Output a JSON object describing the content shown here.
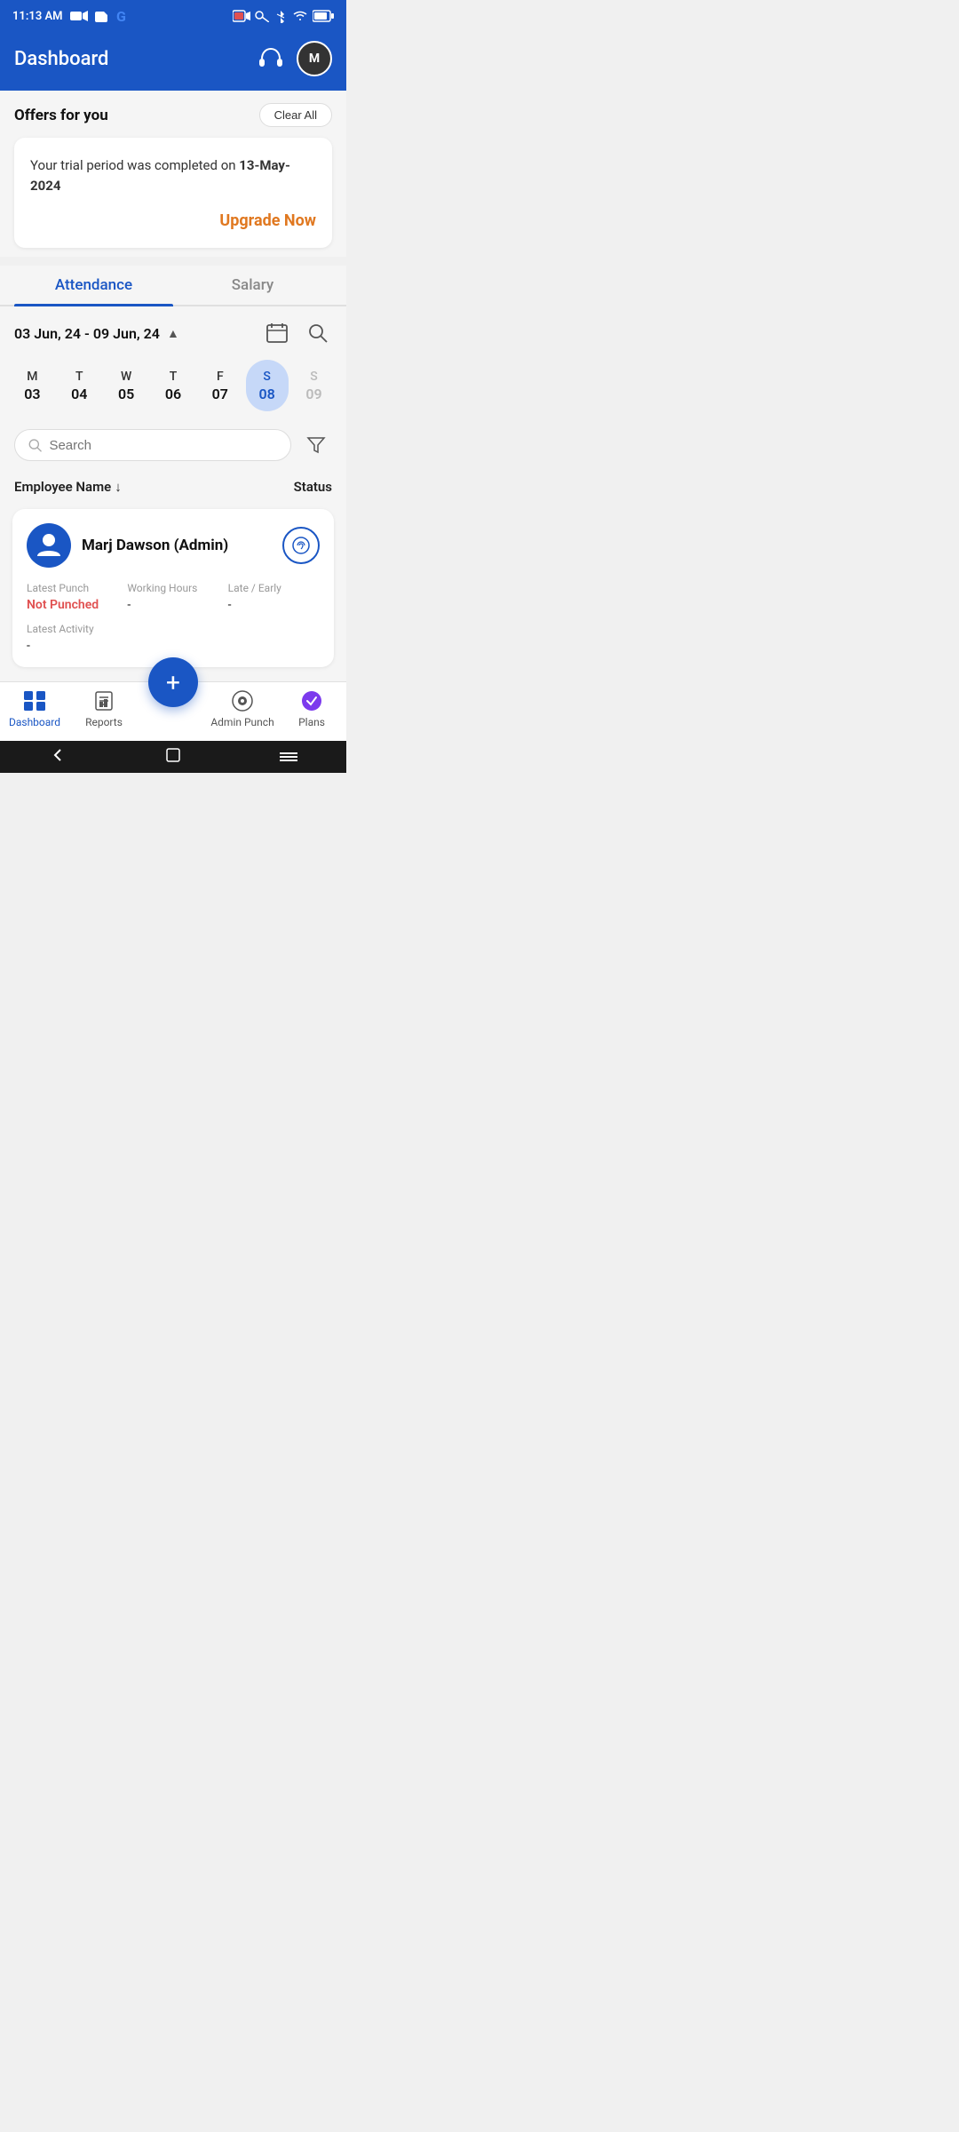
{
  "statusBar": {
    "time": "11:13 AM",
    "icons": [
      "video-icon",
      "sim-icon",
      "google-icon",
      "record-icon",
      "key-icon",
      "bluetooth-icon",
      "wifi-icon",
      "battery-icon"
    ]
  },
  "header": {
    "title": "Dashboard",
    "headsetAlt": "headset",
    "avatarInitial": "M"
  },
  "offers": {
    "sectionTitle": "Offers for you",
    "clearAllLabel": "Clear All",
    "offerMessage1": "Your trial period was completed on ",
    "offerDate": "13-May-2024",
    "upgradeLabel": "Upgrade Now"
  },
  "tabs": [
    {
      "id": "attendance",
      "label": "Attendance",
      "active": true
    },
    {
      "id": "salary",
      "label": "Salary",
      "active": false
    }
  ],
  "dateRange": {
    "text": "03 Jun, 24 - 09 Jun, 24",
    "chevron": "▲"
  },
  "days": [
    {
      "letter": "M",
      "num": "03",
      "active": false,
      "muted": false
    },
    {
      "letter": "T",
      "num": "04",
      "active": false,
      "muted": false
    },
    {
      "letter": "W",
      "num": "05",
      "active": false,
      "muted": false
    },
    {
      "letter": "T",
      "num": "06",
      "active": false,
      "muted": false
    },
    {
      "letter": "F",
      "num": "07",
      "active": false,
      "muted": false
    },
    {
      "letter": "S",
      "num": "08",
      "active": true,
      "muted": false
    },
    {
      "letter": "S",
      "num": "09",
      "active": false,
      "muted": true
    }
  ],
  "search": {
    "placeholder": "Search"
  },
  "table": {
    "colEmployee": "Employee Name",
    "colStatus": "Status",
    "sortIcon": "↓"
  },
  "employees": [
    {
      "name": "Marj Dawson (Admin)",
      "latestPunchLabel": "Latest Punch",
      "latestPunchValue": "Not Punched",
      "workingHoursLabel": "Working Hours",
      "workingHoursValue": "-",
      "lateEarlyLabel": "Late / Early",
      "lateEarlyValue": "-",
      "latestActivityLabel": "Latest Activity",
      "latestActivityValue": "-"
    }
  ],
  "bottomNav": {
    "fabLabel": "+",
    "items": [
      {
        "id": "dashboard",
        "label": "Dashboard",
        "active": true
      },
      {
        "id": "reports",
        "label": "Reports",
        "active": false
      },
      {
        "id": "fab-spacer",
        "label": "",
        "active": false
      },
      {
        "id": "admin-punch",
        "label": "Admin Punch",
        "active": false
      },
      {
        "id": "plans",
        "label": "Plans",
        "active": false
      }
    ]
  },
  "systemNav": {
    "back": "‹",
    "home": "□",
    "menu": "≡"
  }
}
